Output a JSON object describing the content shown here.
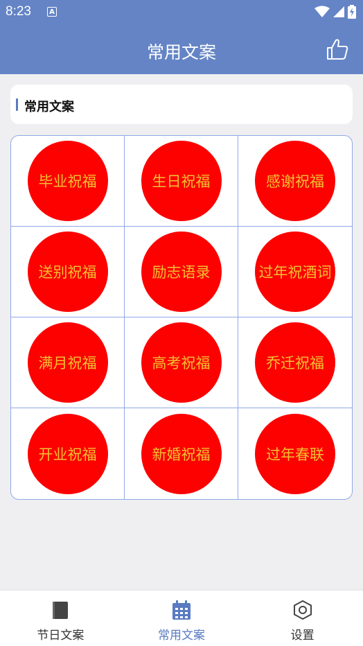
{
  "status_bar": {
    "time": "8:23",
    "notif_letter": "A"
  },
  "app_bar": {
    "title": "常用文案",
    "action_icon": "thumbs-up-icon"
  },
  "section": {
    "title": "常用文案"
  },
  "grid": {
    "items": [
      {
        "label": "毕业祝福"
      },
      {
        "label": "生日祝福"
      },
      {
        "label": "感谢祝福"
      },
      {
        "label": "送别祝福"
      },
      {
        "label": "励志语录"
      },
      {
        "label": "过年祝酒词"
      },
      {
        "label": "满月祝福"
      },
      {
        "label": "高考祝福"
      },
      {
        "label": "乔迁祝福"
      },
      {
        "label": "开业祝福"
      },
      {
        "label": "新婚祝福"
      },
      {
        "label": "过年春联"
      }
    ]
  },
  "bottom_nav": {
    "items": [
      {
        "label": "节日文案",
        "icon": "book-icon",
        "active": false
      },
      {
        "label": "常用文案",
        "icon": "calendar-icon",
        "active": true
      },
      {
        "label": "设置",
        "icon": "hexagon-nut-icon",
        "active": false
      }
    ]
  },
  "colors": {
    "primary": "#6484c6",
    "circle": "#fd0000",
    "circle_text": "#f2c232",
    "grid_border": "#8fa8e6"
  }
}
